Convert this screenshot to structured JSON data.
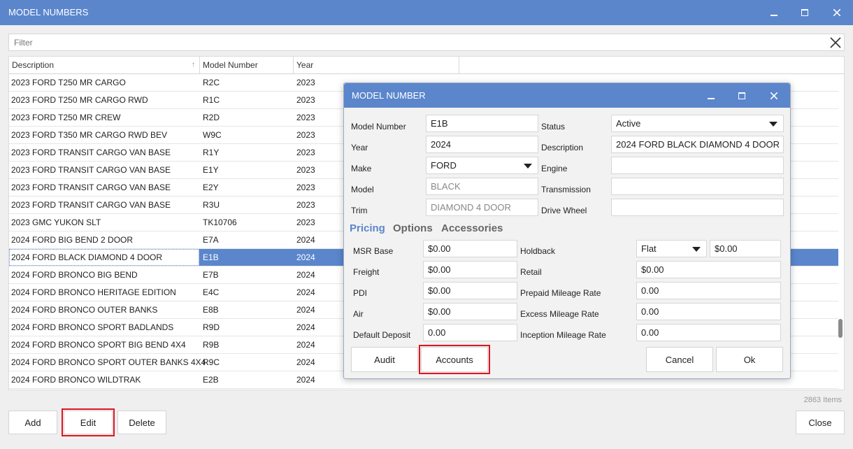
{
  "window": {
    "title": "MODEL NUMBERS"
  },
  "filter": {
    "placeholder": "Filter",
    "value": ""
  },
  "grid": {
    "columns": [
      "Description",
      "Model Number",
      "Year"
    ],
    "rows": [
      {
        "description": "2023 FORD T250 MR CARGO",
        "model": "R2C",
        "year": "2023"
      },
      {
        "description": "2023 FORD T250 MR CARGO RWD",
        "model": "R1C",
        "year": "2023"
      },
      {
        "description": "2023 FORD T250 MR CREW",
        "model": "R2D",
        "year": "2023"
      },
      {
        "description": "2023 FORD T350 MR CARGO RWD BEV",
        "model": "W9C",
        "year": "2023"
      },
      {
        "description": "2023 FORD TRANSIT CARGO VAN BASE",
        "model": "R1Y",
        "year": "2023"
      },
      {
        "description": "2023 FORD TRANSIT CARGO VAN BASE",
        "model": "E1Y",
        "year": "2023"
      },
      {
        "description": "2023 FORD TRANSIT CARGO VAN BASE",
        "model": "E2Y",
        "year": "2023"
      },
      {
        "description": "2023 FORD TRANSIT CARGO VAN BASE",
        "model": "R3U",
        "year": "2023"
      },
      {
        "description": "2023 GMC YUKON SLT",
        "model": "TK10706",
        "year": "2023"
      },
      {
        "description": "2024 FORD BIG BEND 2 DOOR",
        "model": "E7A",
        "year": "2024"
      },
      {
        "description": "2024 FORD BLACK DIAMOND 4 DOOR",
        "model": "E1B",
        "year": "2024"
      },
      {
        "description": "2024 FORD BRONCO BIG BEND",
        "model": "E7B",
        "year": "2024"
      },
      {
        "description": "2024 FORD BRONCO HERITAGE EDITION",
        "model": "E4C",
        "year": "2024"
      },
      {
        "description": "2024 FORD BRONCO OUTER BANKS",
        "model": "E8B",
        "year": "2024"
      },
      {
        "description": "2024 FORD BRONCO SPORT BADLANDS",
        "model": "R9D",
        "year": "2024"
      },
      {
        "description": "2024 FORD BRONCO SPORT BIG BEND 4X4",
        "model": "R9B",
        "year": "2024"
      },
      {
        "description": "2024 FORD BRONCO SPORT OUTER BANKS 4X4",
        "model": "R9C",
        "year": "2024"
      },
      {
        "description": "2024 FORD BRONCO WILDTRAK",
        "model": "E2B",
        "year": "2024"
      }
    ],
    "selected_index": 10,
    "items_count": "2863 Items"
  },
  "buttons": {
    "add": "Add",
    "edit": "Edit",
    "delete": "Delete",
    "close": "Close"
  },
  "dialog": {
    "title": "MODEL NUMBER",
    "labels": {
      "model_number": "Model Number",
      "year": "Year",
      "make": "Make",
      "model": "Model",
      "trim": "Trim",
      "status": "Status",
      "description": "Description",
      "engine": "Engine",
      "transmission": "Transmission",
      "drive_wheel": "Drive Wheel"
    },
    "values": {
      "model_number": "E1B",
      "year": "2024",
      "make": "FORD",
      "model": "BLACK",
      "trim": "DIAMOND 4 DOOR",
      "status": "Active",
      "description": "2024 FORD BLACK DIAMOND 4 DOOR",
      "engine": "",
      "transmission": "",
      "drive_wheel": ""
    },
    "tabs": [
      "Pricing",
      "Options",
      "Accessories"
    ],
    "active_tab": "Pricing",
    "pricing": {
      "labels": {
        "msr_base": "MSR Base",
        "freight": "Freight",
        "pdi": "PDI",
        "air": "Air",
        "default_deposit": "Default Deposit",
        "holdback": "Holdback",
        "retail": "Retail",
        "prepaid_mileage": "Prepaid Mileage Rate",
        "excess_mileage": "Excess Mileage Rate",
        "inception_mileage": "Inception Mileage Rate"
      },
      "values": {
        "msr_base": "$0.00",
        "freight": "$0.00",
        "pdi": "$0.00",
        "air": "$0.00",
        "default_deposit": "0.00",
        "holdback_type": "Flat",
        "holdback": "$0.00",
        "retail": "$0.00",
        "prepaid_mileage": "0.00",
        "excess_mileage": "0.00",
        "inception_mileage": "0.00"
      }
    },
    "buttons": {
      "audit": "Audit",
      "accounts": "Accounts",
      "cancel": "Cancel",
      "ok": "Ok"
    }
  },
  "colors": {
    "accent": "#5b86cc",
    "highlight": "#e0141e"
  }
}
